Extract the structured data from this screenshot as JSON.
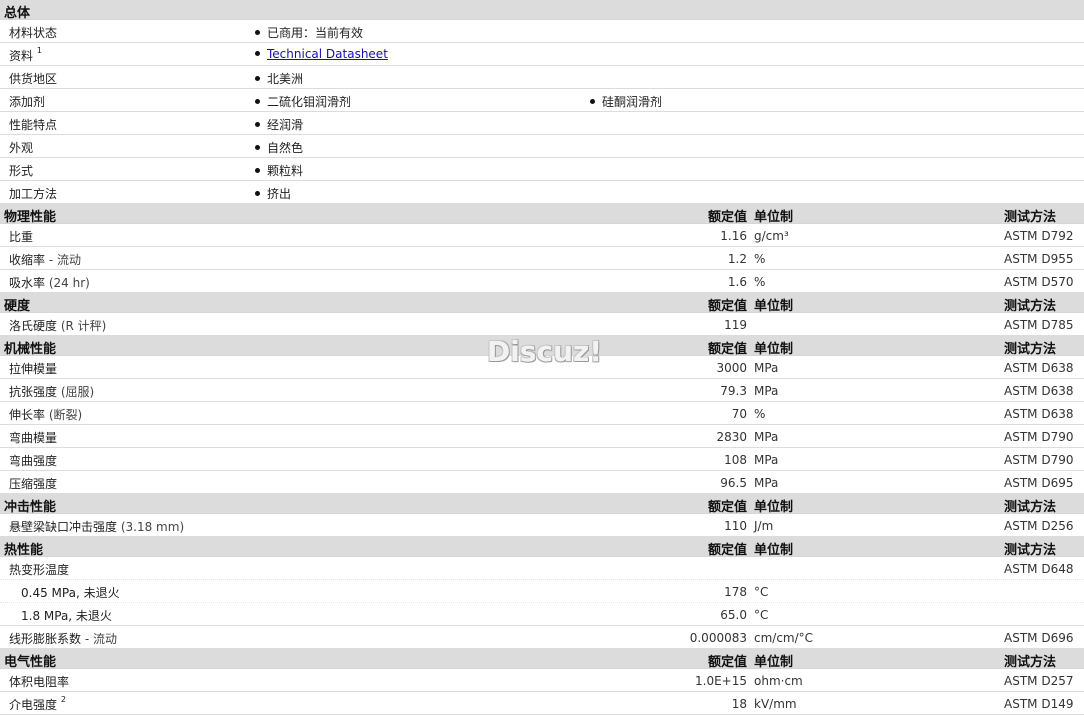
{
  "general": {
    "title": "总体",
    "rows": [
      {
        "label": "材料状态",
        "items": [
          "已商用：当前有效"
        ]
      },
      {
        "label": "资料",
        "sup": "1",
        "items": [
          "Technical Datasheet"
        ],
        "link": true
      },
      {
        "label": "供货地区",
        "items": [
          "北美洲"
        ]
      },
      {
        "label": "添加剂",
        "items": [
          "二硫化钼润滑剂",
          "硅酮润滑剂"
        ]
      },
      {
        "label": "性能特点",
        "items": [
          "经润滑"
        ]
      },
      {
        "label": "外观",
        "items": [
          "自然色"
        ]
      },
      {
        "label": "形式",
        "items": [
          "颗粒料"
        ]
      },
      {
        "label": "加工方法",
        "items": [
          "挤出"
        ]
      }
    ]
  },
  "col_headers": {
    "value": "额定值",
    "unit": "单位制",
    "method": "测试方法"
  },
  "sections": [
    {
      "title": "物理性能",
      "rows": [
        {
          "label": "比重",
          "value": "1.16",
          "unit": "g/cm³",
          "method": "ASTM D792"
        },
        {
          "label": "收缩率",
          "suffix": "- 流动",
          "value": "1.2",
          "unit": "%",
          "method": "ASTM D955"
        },
        {
          "label": "吸水率",
          "suffix": "(24 hr)",
          "value": "1.6",
          "unit": "%",
          "method": "ASTM D570"
        }
      ]
    },
    {
      "title": "硬度",
      "rows": [
        {
          "label": "洛氏硬度",
          "suffix": "(R 计秤)",
          "value": "119",
          "unit": "",
          "method": "ASTM D785"
        }
      ]
    },
    {
      "title": "机械性能",
      "rows": [
        {
          "label": "拉伸模量",
          "value": "3000",
          "unit": "MPa",
          "method": "ASTM D638"
        },
        {
          "label": "抗张强度",
          "suffix": "(屈服)",
          "value": "79.3",
          "unit": "MPa",
          "method": "ASTM D638"
        },
        {
          "label": "伸长率",
          "suffix": "(断裂)",
          "value": "70",
          "unit": "%",
          "method": "ASTM D638"
        },
        {
          "label": "弯曲模量",
          "value": "2830",
          "unit": "MPa",
          "method": "ASTM D790"
        },
        {
          "label": "弯曲强度",
          "value": "108",
          "unit": "MPa",
          "method": "ASTM D790"
        },
        {
          "label": "压缩强度",
          "value": "96.5",
          "unit": "MPa",
          "method": "ASTM D695"
        }
      ]
    },
    {
      "title": "冲击性能",
      "rows": [
        {
          "label": "悬壁梁缺口冲击强度",
          "suffix": "(3.18 mm)",
          "value": "110",
          "unit": "J/m",
          "method": "ASTM D256"
        }
      ]
    },
    {
      "title": "热性能",
      "rows": [
        {
          "label": "热变形温度",
          "value": "",
          "unit": "",
          "method": "ASTM D648",
          "nob": true
        },
        {
          "label": "0.45 MPa, 未退火",
          "indent": true,
          "value": "178",
          "unit": "°C",
          "method": "",
          "nob": true
        },
        {
          "label": "1.8 MPa, 未退火",
          "indent": true,
          "value": "65.0",
          "unit": "°C",
          "method": ""
        },
        {
          "label": "线形膨胀系数",
          "suffix": "- 流动",
          "value": "0.000083",
          "unit": "cm/cm/°C",
          "method": "ASTM D696"
        }
      ]
    },
    {
      "title": "电气性能",
      "rows": [
        {
          "label": "体积电阻率",
          "value": "1.0E+15",
          "unit": "ohm·cm",
          "method": "ASTM D257"
        },
        {
          "label": "介电强度",
          "sup": "2",
          "value": "18",
          "unit": "kV/mm",
          "method": "ASTM D149"
        }
      ]
    }
  ],
  "watermark": "Discuz!"
}
